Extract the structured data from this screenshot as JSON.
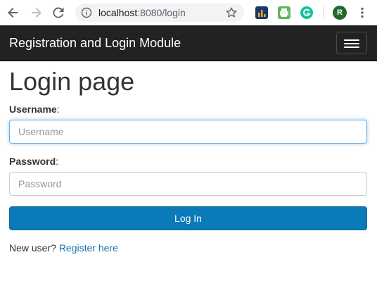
{
  "browser": {
    "url_host": "localhost",
    "url_port_path": ":8080/login",
    "avatar_letter": "R"
  },
  "navbar": {
    "brand": "Registration and Login Module"
  },
  "page": {
    "title": "Login page"
  },
  "form": {
    "username_label": "Username",
    "username_placeholder": "Username",
    "password_label": "Password",
    "password_placeholder": "Password",
    "submit_label": "Log In",
    "label_suffix": ":"
  },
  "signup": {
    "prompt": "New user?",
    "link_text": "Register here"
  },
  "colors": {
    "navbar_bg": "#222222",
    "primary_button": "#0a7ab8",
    "link": "#1a73ad",
    "focus_border": "#66afe9"
  }
}
